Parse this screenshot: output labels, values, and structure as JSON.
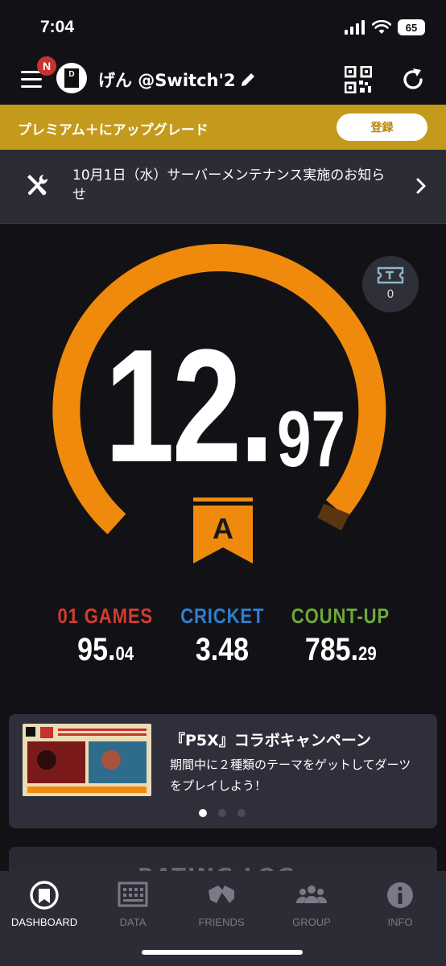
{
  "status_bar": {
    "time": "7:04",
    "battery": "65"
  },
  "header": {
    "notification_badge": "N",
    "avatar_letter": "D",
    "username": "げん @Switch'2"
  },
  "premium": {
    "text": "プレミアム＋にアップグレード",
    "button": "登録"
  },
  "notice": {
    "text": "10月1日（水）サーバーメンテナンス実施のお知らせ"
  },
  "ticket": {
    "count": "0"
  },
  "rating": {
    "integer": "12.",
    "decimal": "97",
    "grade": "A",
    "gauge_fill_fraction": 0.94,
    "color": "#f08a0c"
  },
  "stats": [
    {
      "label": "01 GAMES",
      "whole": "95.",
      "frac": "04",
      "color": "#d23c32"
    },
    {
      "label": "CRICKET",
      "whole": "3.48",
      "frac": "",
      "color": "#2e7fd0"
    },
    {
      "label": "COUNT-UP",
      "whole": "785.",
      "frac": "29",
      "color": "#6ea83a"
    }
  ],
  "campaign": {
    "title": "『P5X』コラボキャンペーン",
    "description": "期間中に２種類のテーマをゲットしてダーツをプレイしよう！",
    "dots": 3,
    "active_dot": 0
  },
  "next_card": {
    "title": "RATING LOG"
  },
  "tabs": [
    {
      "label": "DASHBOARD",
      "icon": "dashboard-icon",
      "active": true
    },
    {
      "label": "DATA",
      "icon": "data-icon",
      "active": false
    },
    {
      "label": "FRIENDS",
      "icon": "friends-icon",
      "active": false
    },
    {
      "label": "GROUP",
      "icon": "group-icon",
      "active": false
    },
    {
      "label": "INFO",
      "icon": "info-icon",
      "active": false
    }
  ]
}
